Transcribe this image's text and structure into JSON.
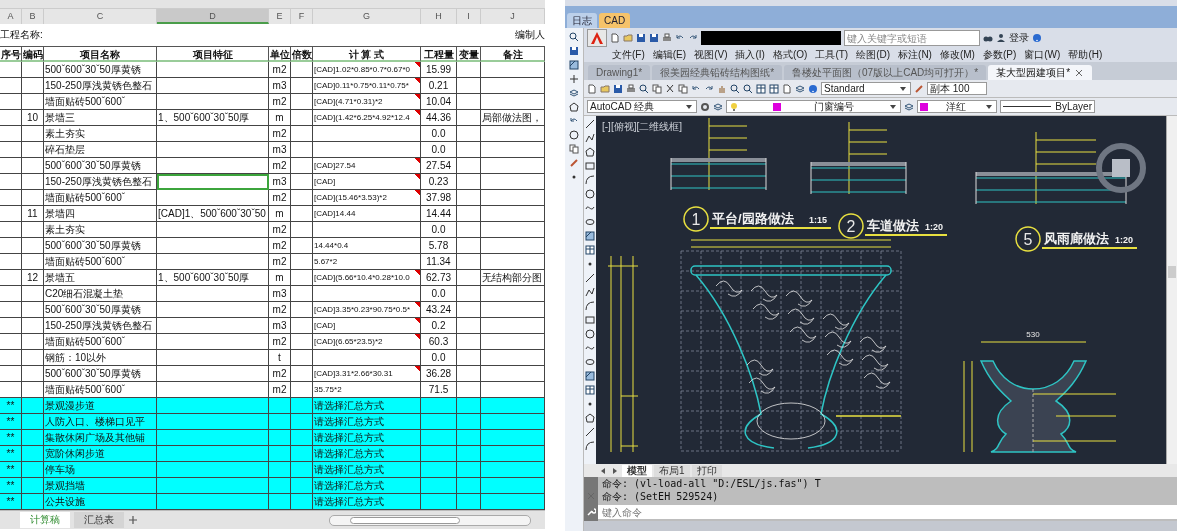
{
  "spreadsheet": {
    "columns": [
      {
        "letter": "A",
        "selected": false
      },
      {
        "letter": "B",
        "selected": false
      },
      {
        "letter": "C",
        "selected": false
      },
      {
        "letter": "D",
        "selected": true
      },
      {
        "letter": "E",
        "selected": false
      },
      {
        "letter": "F",
        "selected": false
      },
      {
        "letter": "G",
        "selected": false
      },
      {
        "letter": "H",
        "selected": false
      },
      {
        "letter": "I",
        "selected": false
      },
      {
        "letter": "J",
        "selected": false
      }
    ],
    "project_label": "工程名称:",
    "author_label": "编制人",
    "headers": [
      "序号",
      "编码",
      "项目名称",
      "项目特征",
      "单位",
      "倍数",
      "计 算 式",
      "工程量",
      "变量",
      "备注"
    ],
    "rows": [
      {
        "kind": "item",
        "selected": false,
        "commented": true,
        "name": "500ˇ600ˇ30ˇ50厚黄锈",
        "unit": "m2",
        "formula": "[CAD]1.02*0.85*0.7*0.67*0",
        "quantity": "15.99"
      },
      {
        "kind": "item",
        "selected": false,
        "commented": true,
        "name": "150-250厚浅黄锈色整石",
        "unit": "m3",
        "formula": "[CAD]0.11*0.75*0.11*0.75*",
        "quantity": "0.21"
      },
      {
        "kind": "item",
        "selected": false,
        "commented": true,
        "name": "墙面贴砖500ˇ600ˇ",
        "unit": "m2",
        "formula": "[CAD](4.71*0.31)*2",
        "quantity": "10.04"
      },
      {
        "kind": "item",
        "selected": false,
        "commented": true,
        "code": "10",
        "name": "景墙三",
        "feature": "1、500ˇ600ˇ30ˇ50厚",
        "unit": "m",
        "formula": "[CAD](1.42*6.25*4.92*12.4",
        "quantity": "44.36",
        "note": "局部做法图，"
      },
      {
        "kind": "item",
        "selected": false,
        "commented": false,
        "name": "素土夯实",
        "unit": "m2",
        "quantity": "0.0"
      },
      {
        "kind": "item",
        "selected": false,
        "commented": false,
        "name": "碎石垫层",
        "unit": "m3",
        "quantity": "0.0"
      },
      {
        "kind": "item",
        "selected": false,
        "commented": true,
        "name": "500ˇ600ˇ30ˇ50厚黄锈",
        "unit": "m2",
        "formula": "[CAD]27.54",
        "quantity": "27.54"
      },
      {
        "kind": "item",
        "selected": true,
        "commented": true,
        "name": "150-250厚浅黄锈色整石",
        "unit": "m3",
        "formula": "[CAD]",
        "quantity": "0.23"
      },
      {
        "kind": "item",
        "selected": false,
        "commented": true,
        "name": "墙面贴砖500ˇ600ˇ",
        "unit": "m2",
        "formula": "[CAD](15.46*3.53)*2",
        "quantity": "37.98"
      },
      {
        "kind": "item",
        "selected": false,
        "commented": false,
        "code": "11",
        "name": "景墙四",
        "feature": "[CAD]1、500ˇ600ˇ30ˇ50",
        "unit": "m",
        "formula": "[CAD]14.44",
        "quantity": "14.44"
      },
      {
        "kind": "item",
        "selected": false,
        "commented": false,
        "name": "素土夯实",
        "unit": "m2",
        "quantity": "0.0"
      },
      {
        "kind": "item",
        "selected": false,
        "commented": false,
        "name": "500ˇ600ˇ30ˇ50厚黄锈",
        "unit": "m2",
        "formula": "14.44*0.4",
        "quantity": "5.78"
      },
      {
        "kind": "item",
        "selected": false,
        "commented": false,
        "name": "墙面贴砖500ˇ600ˇ",
        "unit": "m2",
        "formula": "5.67*2",
        "quantity": "11.34"
      },
      {
        "kind": "item",
        "selected": false,
        "commented": true,
        "code": "12",
        "name": "景墙五",
        "feature": "1、500ˇ600ˇ30ˇ50厚",
        "unit": "m",
        "formula": "[CAD](5.66*10.4*0.28*10.0",
        "quantity": "62.73",
        "note": "无结构部分图"
      },
      {
        "kind": "item",
        "selected": false,
        "commented": false,
        "name": "C20细石混凝土垫",
        "unit": "m3",
        "quantity": "0.0"
      },
      {
        "kind": "item",
        "selected": false,
        "commented": true,
        "name": "500ˇ600ˇ30ˇ50厚黄锈",
        "unit": "m2",
        "formula": "[CAD]3.35*0.23*90.75*0.5*",
        "quantity": "43.24"
      },
      {
        "kind": "item",
        "selected": false,
        "commented": true,
        "name": "150-250厚浅黄锈色整石",
        "unit": "m3",
        "formula": "[CAD]",
        "quantity": "0.2"
      },
      {
        "kind": "item",
        "selected": false,
        "commented": true,
        "name": "墙面贴砖500ˇ600ˇ",
        "unit": "m2",
        "formula": "[CAD](6.65*23.5)*2",
        "quantity": "60.3"
      },
      {
        "kind": "item",
        "selected": false,
        "commented": false,
        "name": "钢筋：10以外",
        "unit": "t",
        "quantity": "0.0"
      },
      {
        "kind": "item",
        "selected": false,
        "commented": true,
        "name": "500ˇ600ˇ30ˇ50厚黄锈",
        "unit": "m2",
        "formula": "[CAD]3.31*2.66*30.31",
        "quantity": "36.28"
      },
      {
        "kind": "item",
        "selected": false,
        "commented": false,
        "name": "墙面贴砖500ˇ600ˇ",
        "unit": "m2",
        "formula": "35.75*2",
        "quantity": "71.5"
      },
      {
        "kind": "summary",
        "selected": false,
        "commented": false,
        "no": "**",
        "name": "景观漫步道",
        "formula": "请选择汇总方式"
      },
      {
        "kind": "summary",
        "selected": false,
        "commented": false,
        "no": "**",
        "name": "人防入口、楼梯口见平",
        "formula": "请选择汇总方式"
      },
      {
        "kind": "summary",
        "selected": false,
        "commented": false,
        "no": "**",
        "name": "集散休闲广场及其他铺",
        "formula": "请选择汇总方式"
      },
      {
        "kind": "summary",
        "selected": false,
        "commented": false,
        "no": "**",
        "name": "宽阶休闲步道",
        "formula": "请选择汇总方式"
      },
      {
        "kind": "summary",
        "selected": false,
        "commented": false,
        "no": "**",
        "name": "停车场",
        "formula": "请选择汇总方式"
      },
      {
        "kind": "summary",
        "selected": false,
        "commented": false,
        "no": "**",
        "name": "景观挡墙",
        "formula": "请选择汇总方式"
      },
      {
        "kind": "summary",
        "selected": false,
        "commented": false,
        "no": "**",
        "name": "公共设施",
        "formula": "请选择汇总方式"
      }
    ],
    "sheet_tabs": [
      {
        "label": "计算稿",
        "selected": true
      },
      {
        "label": "汇总表",
        "selected": false
      }
    ]
  },
  "cad": {
    "app_tabs": [
      {
        "label": "日志",
        "selected": false
      },
      {
        "label": "CAD",
        "selected": true
      }
    ],
    "search_placeholder": "键入关键字或短语",
    "login": "登录",
    "menu": [
      "文件(F)",
      "编辑(E)",
      "视图(V)",
      "插入(I)",
      "格式(O)",
      "工具(T)",
      "绘图(D)",
      "标注(N)",
      "修改(M)",
      "参数(P)",
      "窗口(W)",
      "帮助(H)"
    ],
    "doc_tabs": [
      {
        "label": "Drawing1*",
        "selected": false
      },
      {
        "label": "很美园经典铅砖结构图纸*",
        "selected": false
      },
      {
        "label": "鲁楼处平面图（07版以上CAD均可打开）*",
        "selected": false
      },
      {
        "label": "某大型园建项目*",
        "selected": true
      }
    ],
    "text_style": "Standard",
    "dim_style": "副本 100",
    "workspace": "AutoCAD 经典",
    "layer": "门窗编号",
    "color_name": "洋红",
    "linetype": "ByLayer",
    "viewport_label": "[-][俯视][二维线框]",
    "details": [
      {
        "number": "1",
        "title": "平台/园路做法",
        "scale": "1:15"
      },
      {
        "number": "2",
        "title": "车道做法",
        "scale": "1:20"
      },
      {
        "number": "5",
        "title": "风雨廊做法",
        "scale": "1:20"
      }
    ],
    "dimension": "530",
    "layout_tabs": [
      {
        "label": "模型",
        "selected": true
      },
      {
        "label": "布局1",
        "selected": false
      },
      {
        "label": "打印",
        "selected": false
      }
    ],
    "command_history": [
      "命令: (vl-load-all \"D:/ESL/js.fas\") T",
      "命令: (SetEH 529524)"
    ],
    "command_placeholder": "键入命令"
  }
}
